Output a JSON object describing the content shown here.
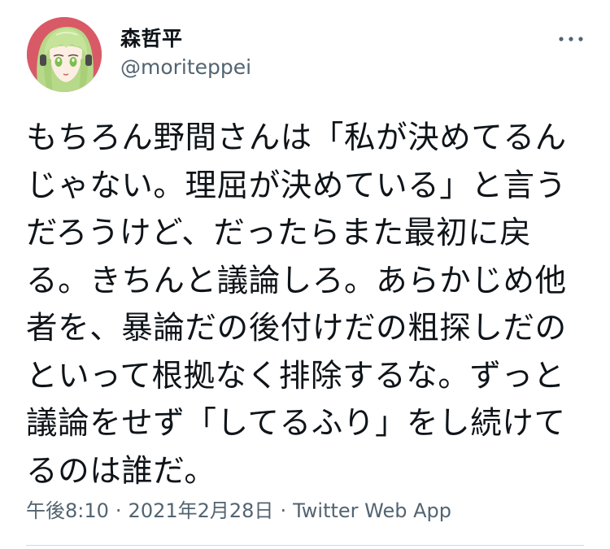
{
  "author": {
    "display_name": "森哲平",
    "handle": "@moriteppei",
    "avatar": "anime-character-avatar"
  },
  "more_icon": "more-horizontal-icon",
  "tweet": {
    "lines": [
      "もちろん野間さんは「私が決めてるん",
      "じゃない。理屈が決めている」と言う",
      "だろうけど、だったらまた最初に戻",
      "る。きちんと議論しろ。あらかじめ他",
      "者を、暴論だの後付けだの粗探しだの",
      "といって根拠なく排除するな。ずっと",
      "議論をせず「してるふり」をし続けて",
      "るのは誰だ。"
    ]
  },
  "meta": {
    "time": "午後8:10",
    "separator": "·",
    "date": "2021年2月28日",
    "source": "Twitter Web App"
  },
  "colors": {
    "text": "#0f1419",
    "secondary": "#536471",
    "divider": "#cfd9de",
    "avatar_bg": "#d95a67"
  }
}
